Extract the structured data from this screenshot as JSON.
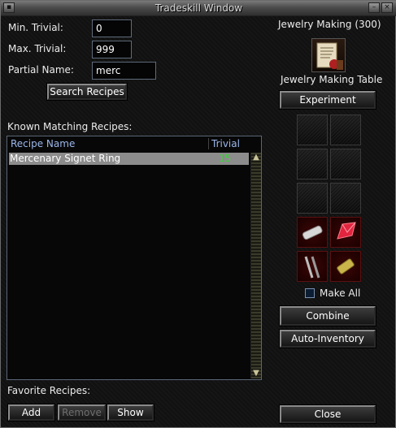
{
  "window": {
    "title": "Tradeskill Window"
  },
  "search": {
    "min_trivial_label": "Min. Trivial:",
    "min_trivial_value": "0",
    "max_trivial_label": "Max. Trivial:",
    "max_trivial_value": "999",
    "partial_name_label": "Partial Name:",
    "partial_name_value": "merc",
    "search_button": "Search Recipes"
  },
  "recipes": {
    "section_label": "Known Matching Recipes:",
    "columns": [
      "Recipe Name",
      "Trivial"
    ],
    "rows": [
      {
        "name": "Mercenary Signet Ring",
        "trivial": "15"
      }
    ],
    "trivial_color": "#3fd23f",
    "header_color": "#9cb6ea"
  },
  "favorites": {
    "label": "Favorite Recipes:",
    "add_button": "Add",
    "remove_button": "Remove",
    "show_button": "Show"
  },
  "container": {
    "skill": "Jewelry Making (300)",
    "name": "Jewelry Making Table",
    "experiment_button": "Experiment",
    "slot_items": [
      "empty",
      "empty",
      "empty",
      "empty",
      "empty",
      "empty",
      "silver-bar",
      "ruby",
      "wire-tools",
      "gold-bar"
    ],
    "make_all_label": "Make All",
    "combine_button": "Combine",
    "auto_inventory_button": "Auto-Inventory",
    "close_button": "Close"
  }
}
